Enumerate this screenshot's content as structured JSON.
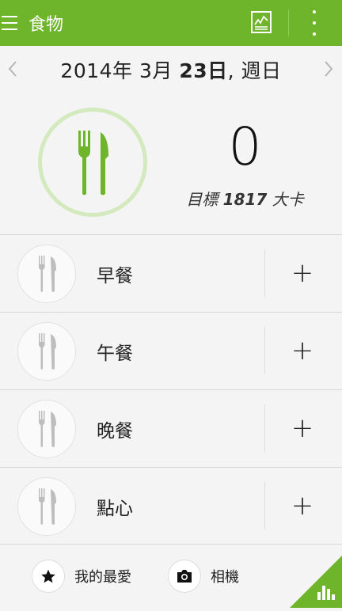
{
  "topbar": {
    "title": "食物",
    "menu_icon": "hamburger-menu-icon",
    "trend_icon": "chart-trend-icon",
    "more_icon": "overflow-menu-icon"
  },
  "date": {
    "prefix": "2014年 3月 ",
    "day": "23日",
    "suffix": ", 週日"
  },
  "summary": {
    "kcal": "0",
    "goal_prefix": "目標 ",
    "goal_value": "1817",
    "goal_unit": " 大卡"
  },
  "meals": [
    {
      "label": "早餐",
      "add": "+"
    },
    {
      "label": "午餐",
      "add": "+"
    },
    {
      "label": "晚餐",
      "add": "+"
    },
    {
      "label": "點心",
      "add": "+"
    }
  ],
  "bottom": {
    "favorites": "我的最愛",
    "camera": "相機"
  },
  "colors": {
    "accent": "#6fb52c",
    "ring": "#d3e9be"
  }
}
